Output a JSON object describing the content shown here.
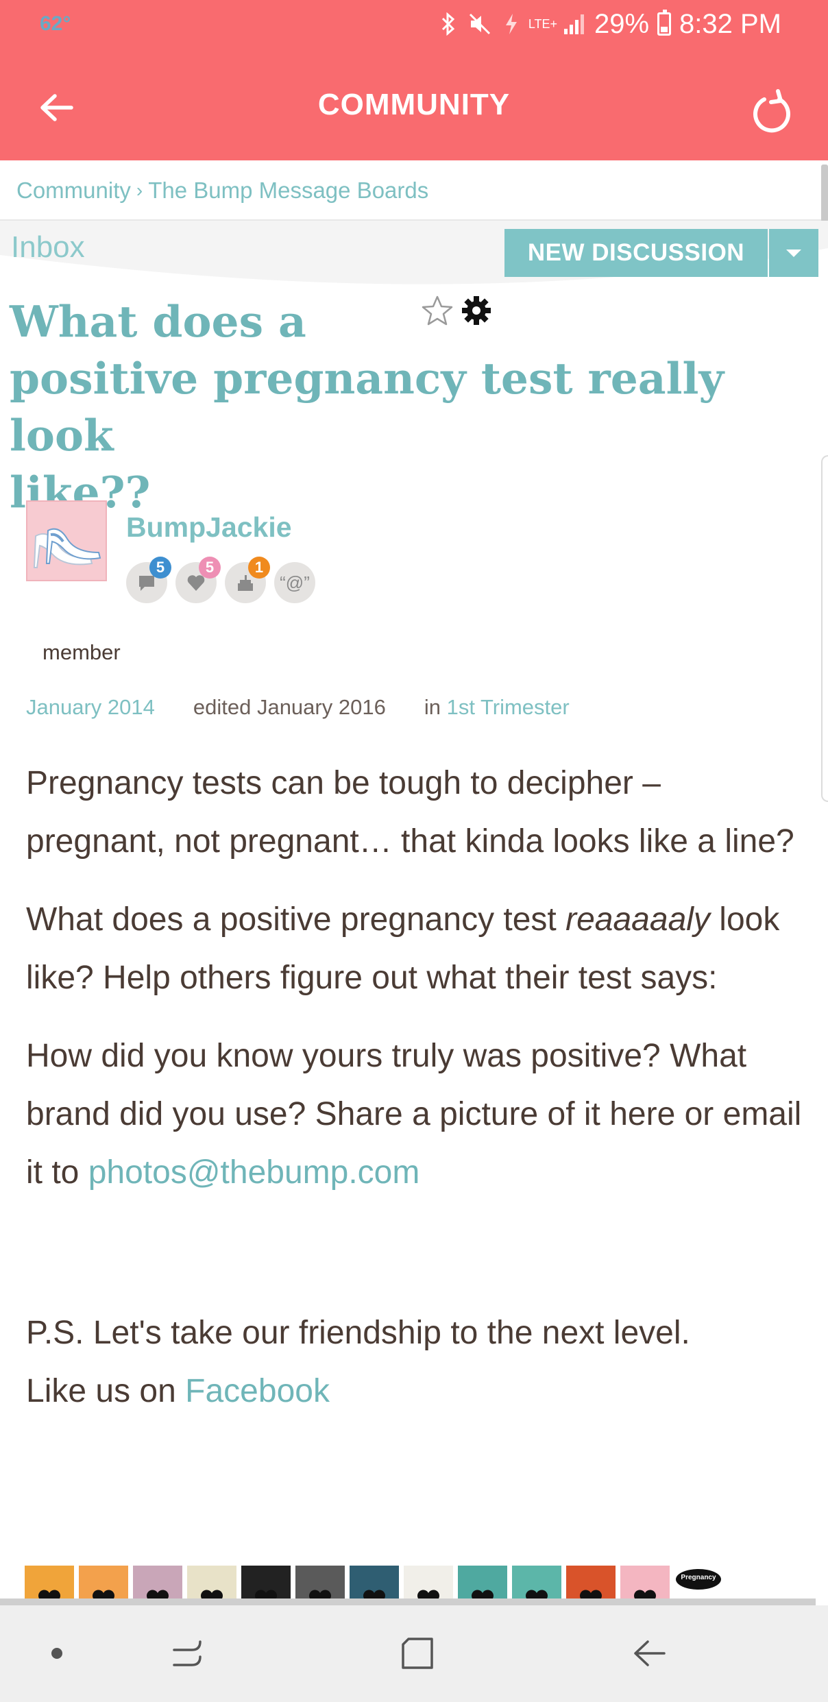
{
  "status_bar": {
    "temperature": "62°",
    "network": "LTE+",
    "battery": "29%",
    "time": "8:32 PM",
    "icons": [
      "bluetooth-icon",
      "mute-icon",
      "data-saver-icon",
      "signal-icon",
      "battery-icon"
    ]
  },
  "app_bar": {
    "title": "COMMUNITY",
    "background": "#f96b6f",
    "icons": [
      "back-arrow-icon",
      "refresh-icon"
    ]
  },
  "breadcrumb": {
    "items": [
      "Community",
      "The Bump Message Boards"
    ],
    "separator": "›"
  },
  "toolbar": {
    "inbox_label": "Inbox",
    "new_discussion_label": "NEW DISCUSSION",
    "accent": "#7fc4c6"
  },
  "thread": {
    "title_lines": [
      "What does a",
      "positive pregnancy test really look",
      "like??"
    ],
    "icons": [
      "star-icon",
      "gear-icon"
    ]
  },
  "author": {
    "name": "BumpJackie",
    "role": "member",
    "badges": [
      {
        "icon": "comment-icon",
        "count": "5",
        "color": "#3e8fd0"
      },
      {
        "icon": "heart-icon",
        "count": "5",
        "color": "#ee8fb4"
      },
      {
        "icon": "cake-icon",
        "count": "1",
        "color": "#f08a1e"
      },
      {
        "icon": "mention-icon",
        "label": "“@”"
      }
    ]
  },
  "meta": {
    "posted": "January 2014",
    "edited": "edited January 2016",
    "in_label": "in",
    "category": "1st Trimester"
  },
  "body": {
    "p1": "Pregnancy tests can be tough to decipher – pregnant, not pregnant… that kinda looks like a line?",
    "p2_before": "What does a positive pregnancy test ",
    "p2_emphasis": "reaaaaaly",
    "p2_after": " look like? Help others figure out what their test says:",
    "p3_before": "How did you know yours truly was positive? What brand did you use? Share a picture of it here or email it to ",
    "p3_email": "photos@thebump.com",
    "p4_line1": "P.S. Let's take our friendship to the next level.",
    "p4_before": "Like us on ",
    "p4_link": "Facebook"
  },
  "reactions": {
    "last_label": "Pregnancy",
    "count": 13
  },
  "nav_bar": {
    "icons": [
      "dot-icon",
      "recent-apps-icon",
      "home-icon",
      "back-icon"
    ]
  }
}
